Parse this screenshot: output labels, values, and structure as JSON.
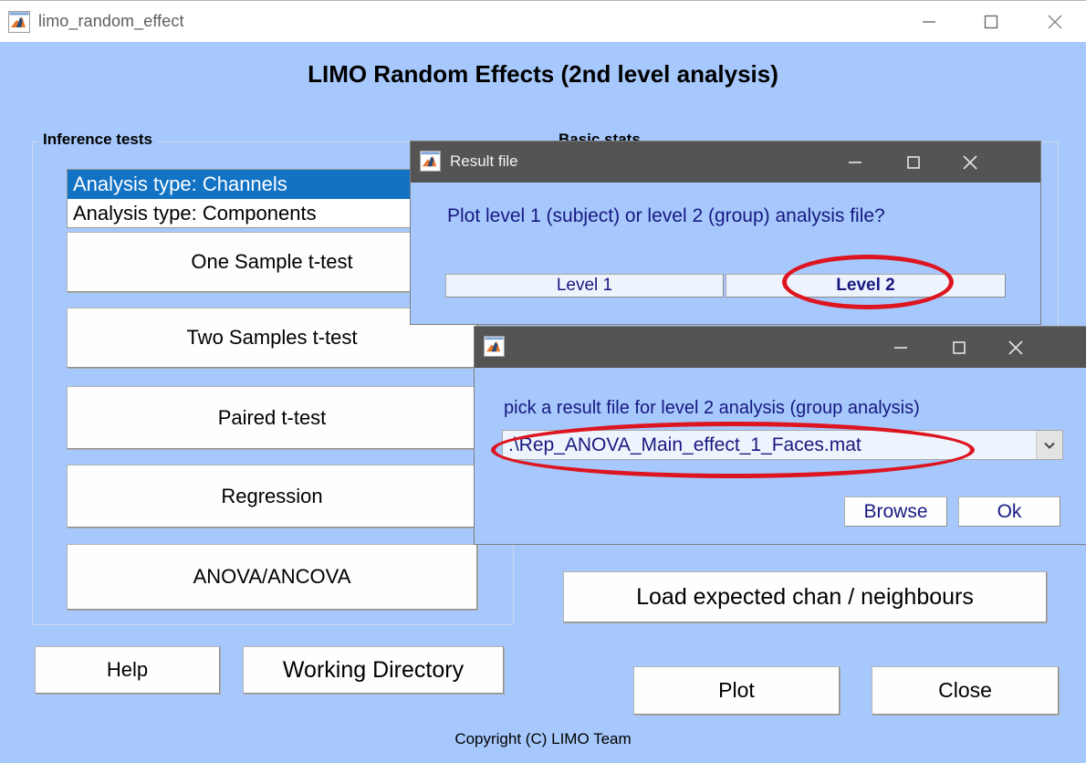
{
  "window": {
    "title": "limo_random_effect",
    "icon": "matlab-icon",
    "controls": {
      "minimize": "minimize-icon",
      "maximize": "maximize-icon",
      "close": "close-icon"
    }
  },
  "page": {
    "title": "LIMO Random Effects (2nd level analysis)",
    "copyright": "Copyright (C) LIMO Team",
    "background_color": "#a6c8fc"
  },
  "groups": {
    "inference": {
      "label": "Inference tests"
    },
    "basic_stats": {
      "label": "Basic stats"
    }
  },
  "analysis_listbox": {
    "name": "analysis-type-listbox",
    "selected_index": 0,
    "selected_color": "#1272c4",
    "items": [
      {
        "label": "Analysis type: Channels"
      },
      {
        "label": "Analysis type: Components"
      }
    ]
  },
  "inference_buttons": [
    {
      "label": "One Sample t-test"
    },
    {
      "label": "Two Samples t-test"
    },
    {
      "label": "Paired t-test"
    },
    {
      "label": "Regression"
    },
    {
      "label": "ANOVA/ANCOVA"
    }
  ],
  "bottom_left_buttons": [
    {
      "label": "Help"
    },
    {
      "label": "Working Directory"
    }
  ],
  "right_buttons": [
    {
      "label": "Load expected chan / neighbours"
    },
    {
      "label": "Plot"
    },
    {
      "label": "Close"
    }
  ],
  "dialog_result_file": {
    "title": "Result file",
    "icon": "matlab-icon",
    "question": "Plot level 1 (subject) or level 2 (group) analysis file?",
    "buttons": [
      {
        "label": "Level 1",
        "bold": false
      },
      {
        "label": "Level 2",
        "bold": true
      }
    ],
    "controls": {
      "minimize": "minimize-icon",
      "maximize": "maximize-icon",
      "close": "close-icon"
    }
  },
  "dialog_file_picker": {
    "title": "",
    "icon": "matlab-icon",
    "prompt": "pick a result file for level 2 analysis (group analysis)",
    "combo": {
      "value": ".\\Rep_ANOVA_Main_effect_1_Faces.mat",
      "arrow_icon": "chevron-down-icon"
    },
    "buttons": [
      {
        "label": "Browse"
      },
      {
        "label": "Ok"
      }
    ],
    "controls": {
      "minimize": "minimize-icon",
      "maximize": "maximize-icon",
      "close": "close-icon"
    }
  },
  "annotations": {
    "color": "#dd1520",
    "items": [
      {
        "target": "Level 2",
        "shape": "ellipse"
      },
      {
        "target": ".\\Rep_ANOVA_Main_effect_1_Faces.mat",
        "shape": "ellipse"
      }
    ]
  }
}
